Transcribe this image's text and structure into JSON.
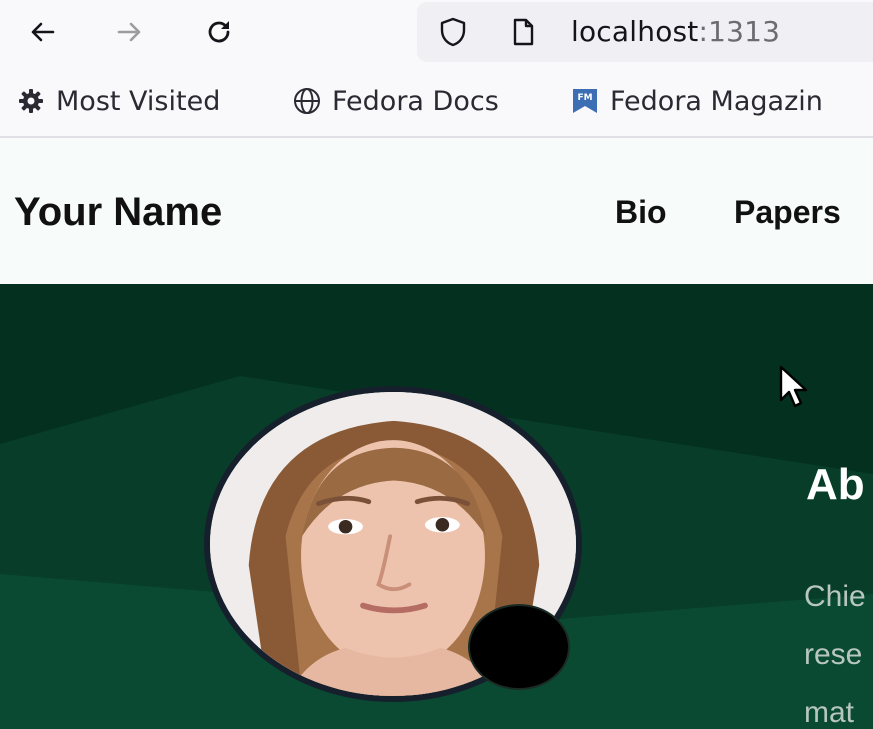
{
  "browser": {
    "url_host": "localhost",
    "url_port": ":1313",
    "icons": [
      "back-arrow-icon",
      "forward-arrow-icon",
      "reload-icon",
      "shield-icon",
      "page-icon"
    ]
  },
  "bookmarks": [
    {
      "label": "Most Visited",
      "icon": "gear-icon"
    },
    {
      "label": "Fedora Docs",
      "icon": "globe-icon"
    },
    {
      "label": "Fedora Magazin",
      "icon": "fedora-magazine-icon"
    }
  ],
  "site": {
    "title": "Your Name",
    "nav": [
      "Bio",
      "Papers"
    ]
  },
  "hero": {
    "about_title": "Ab",
    "about_lines": [
      "Chie",
      "rese",
      "mat"
    ]
  },
  "colors": {
    "hero_bg": "#04301f",
    "hero_band": "#0a4a33",
    "header_bg": "#f7fbf9",
    "status_dot": "#000000"
  }
}
